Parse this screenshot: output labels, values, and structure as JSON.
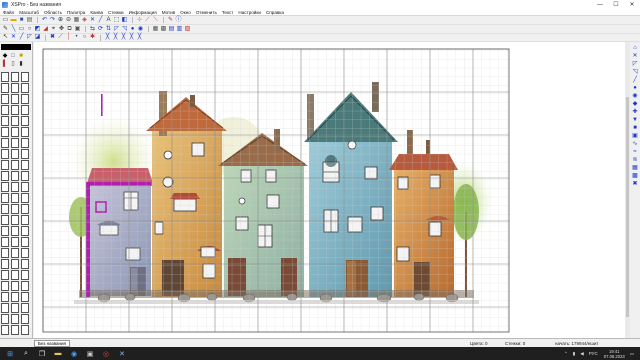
{
  "window": {
    "title": "XSPro - Без названия",
    "controls": [
      "—",
      "☐",
      "✕"
    ]
  },
  "menu": [
    "Файл",
    "Масштаб",
    "Область",
    "Палитра",
    "Канва",
    "Стежки",
    "Информация",
    "Мотив",
    "Окно",
    "Отменить",
    "Текст",
    "Настройки",
    "Справка"
  ],
  "toolbar1_icons": [
    "new-icon",
    "open-icon",
    "save-icon",
    "print-icon",
    "undo-icon",
    "redo-icon",
    "zoom-in-icon",
    "zoom-out-icon",
    "grid-icon",
    "palette-icon",
    "stitch-icon",
    "backstitch-icon",
    "text-icon",
    "select-icon",
    "fill-icon"
  ],
  "toolbar2_icons": [
    "pencil-icon",
    "line-icon",
    "rect-icon",
    "circle-icon",
    "fill-icon",
    "eraser-icon",
    "pick-icon",
    "move-icon",
    "copy-icon",
    "paste-icon",
    "flip-icon",
    "rotate-icon",
    "mirror-icon",
    "center-icon",
    "half-stitch-icon",
    "quarter-stitch-icon",
    "knot-icon",
    "bead-icon"
  ],
  "toolbar3_icons": [
    "arrow-icon",
    "cross-icon",
    "half-icon",
    "quarter-icon",
    "three-quarter-icon",
    "petite-icon",
    "backstitch-icon",
    "straight-icon",
    "french-knot-icon",
    "bead-icon",
    "special-icon"
  ],
  "ruler": {
    "top_labels": [
      "10",
      "20",
      "30",
      "40",
      "50",
      "60",
      "70",
      "80",
      "90",
      "100",
      "110",
      "120",
      "130",
      "140",
      "150",
      "160",
      "170",
      "180",
      "190",
      "200",
      "210",
      "220",
      "230",
      "240",
      "250",
      "260",
      "270",
      "280",
      "290",
      "300",
      "310",
      "320",
      "330",
      "340",
      "350",
      "360",
      "370",
      "380",
      "390",
      "400",
      "410",
      "420",
      "430",
      "440",
      "450",
      "460",
      "470",
      "480",
      "490",
      "500",
      "510",
      "520",
      "530",
      "540",
      "550",
      "560"
    ],
    "left_labels": [
      "10",
      "20",
      "30",
      "40",
      "50",
      "60",
      "70",
      "80",
      "90",
      "100",
      "110",
      "120",
      "130",
      "140",
      "150",
      "160",
      "170",
      "180",
      "190",
      "200",
      "210",
      "220",
      "230",
      "240",
      "250",
      "260",
      "270",
      "280"
    ]
  },
  "status": {
    "tab_label": "Без названия",
    "threads": "Цвета: 0",
    "stitches": "Стежки: 0",
    "coords": "начать: 179944/ешит"
  },
  "taskbar": {
    "icons": [
      "windows-icon",
      "search-icon",
      "taskview-icon",
      "explorer-icon",
      "browser-icon",
      "store-icon",
      "mail-icon",
      "xspro-icon"
    ],
    "lang": "РУС",
    "time": "19:41",
    "date": "07.08.2023"
  },
  "colors": {
    "accent": "#1a38c8",
    "grid_line": "#c9c9c9",
    "grid_major": "#8a8a8a",
    "selection": "#b020b0"
  }
}
